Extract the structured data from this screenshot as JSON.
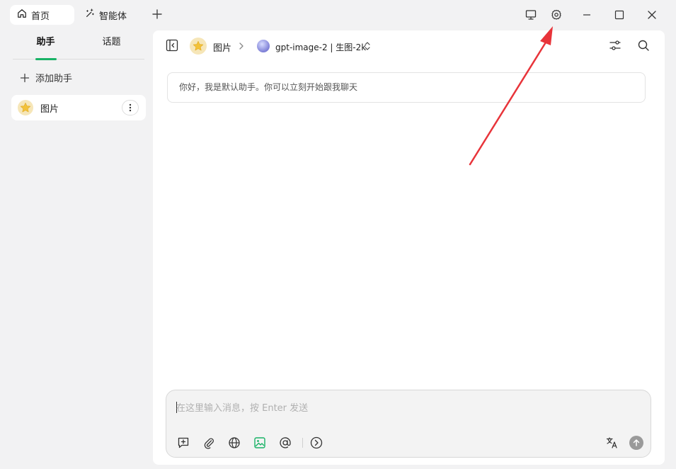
{
  "titlebar": {
    "tabs": [
      {
        "label": "首页",
        "icon": "home-icon",
        "active": true
      },
      {
        "label": "智能体",
        "icon": "sparkle-wand-icon",
        "active": false
      }
    ],
    "add_tab_icon": "plus-icon",
    "window_controls": [
      "monitor-icon",
      "settings-gear-icon",
      "minimize-icon",
      "maximize-icon",
      "close-icon"
    ]
  },
  "sidebar": {
    "tabs": [
      {
        "label": "助手",
        "active": true
      },
      {
        "label": "话题",
        "active": false
      }
    ],
    "add_assistant_label": "添加助手",
    "assistants": [
      {
        "name": "图片",
        "icon": "star-icon"
      }
    ]
  },
  "main": {
    "breadcrumb": {
      "assistant_name": "图片",
      "model_name": "gpt-image-2 | 生图-2k"
    },
    "greeting": "你好，我是默认助手。你可以立刻开始跟我聊天"
  },
  "composer": {
    "placeholder": "在这里输入消息，按 Enter 发送",
    "value": ""
  },
  "colors": {
    "accent_green": "#19b266",
    "annotation_red": "#e8343a",
    "star_yellow": "#f3c23a"
  }
}
